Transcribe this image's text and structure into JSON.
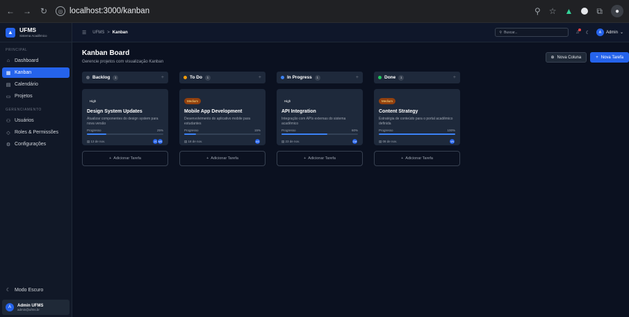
{
  "browser": {
    "url": "localhost:3000/kanban"
  },
  "sidebar": {
    "brand_title": "UFMS",
    "brand_subtitle": "Sistema Acadêmico",
    "section_principal": "PRINCIPAL",
    "section_gerenciamento": "GERENCIAMENTO",
    "items_principal": [
      {
        "label": "Dashboard",
        "icon": "home-icon"
      },
      {
        "label": "Kanban",
        "icon": "kanban-icon",
        "active": true
      },
      {
        "label": "Calendário",
        "icon": "calendar-icon"
      },
      {
        "label": "Projetos",
        "icon": "folder-icon"
      }
    ],
    "items_gerenciamento": [
      {
        "label": "Usuários",
        "icon": "users-icon"
      },
      {
        "label": "Roles & Permissões",
        "icon": "shield-icon"
      },
      {
        "label": "Configurações",
        "icon": "gear-icon"
      }
    ],
    "dark_mode_label": "Modo Escuro",
    "user_name": "Admin UFMS",
    "user_email": "admin@ufms.br",
    "user_initial": "A"
  },
  "topbar": {
    "crumb_root": "UFMS",
    "crumb_separator": ">",
    "crumb_current": "Kanban",
    "search_placeholder": "Buscar...",
    "admin_label": "Admin",
    "admin_initial": "A"
  },
  "page": {
    "title": "Kanban Board",
    "subtitle": "Gerencie projetos com visualização Kanban",
    "new_column_label": "Nova Coluna",
    "new_task_label": "Nova Tarefa"
  },
  "add_task_label": "Adicionar Tarefa",
  "progress_label": "Progresso",
  "columns": [
    {
      "name": "Backlog",
      "count": "1",
      "color": "#6b7280",
      "card": {
        "priority": "High",
        "priority_class": "high",
        "title": "Design System Updates",
        "description": "Atualizar componentes do design system para nova versão",
        "progress": 25,
        "progress_text": "25%",
        "due": "13 de nov.",
        "assignees": [
          "JS",
          "MS"
        ]
      }
    },
    {
      "name": "To Do",
      "count": "1",
      "color": "#f59e0b",
      "card": {
        "priority": "Medium",
        "priority_class": "medium",
        "title": "Mobile App Development",
        "description": "Desenvolvimento do aplicativo mobile para estudantes",
        "progress": 15,
        "progress_text": "15%",
        "due": "18 de nov.",
        "assignees": [
          "AS"
        ]
      }
    },
    {
      "name": "In Progress",
      "count": "1",
      "color": "#3b82f6",
      "card": {
        "priority": "High",
        "priority_class": "high",
        "title": "API Integration",
        "description": "Integração com APIs externas do sistema acadêmico",
        "progress": 60,
        "progress_text": "60%",
        "due": "23 de nov.",
        "assignees": [
          "CM"
        ]
      }
    },
    {
      "name": "Done",
      "count": "1",
      "color": "#22c55e",
      "card": {
        "priority": "Medium",
        "priority_class": "medium",
        "title": "Content Strategy",
        "description": "Estratégia de conteúdo para o portal acadêmico definida",
        "progress": 100,
        "progress_text": "100%",
        "due": "08 de nov.",
        "assignees": [
          "VN"
        ]
      }
    }
  ]
}
